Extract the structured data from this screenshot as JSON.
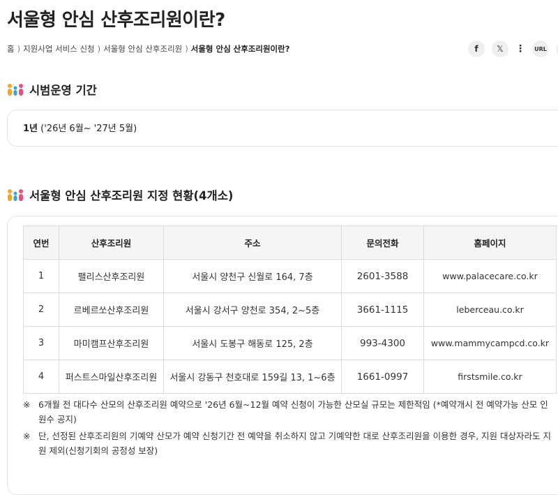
{
  "page_title": "서울형 안심 산후조리원이란?",
  "breadcrumb": {
    "items": [
      "홈",
      "지원사업 서비스 신청",
      "서울형 안심 산후조리원"
    ],
    "separator": ")",
    "current": "서울형 안심 산후조리원이란?"
  },
  "share": {
    "facebook_icon": "f",
    "x_icon": "𝕏",
    "more_icon": "⋮",
    "url_label": "URL"
  },
  "sections": {
    "period": {
      "title": "시범운영 기간",
      "value_bold": "1년",
      "value_rest": " ('26년 6월~ '27년 5월)"
    },
    "centers": {
      "title": "서울형 안심 산후조리원 지정 현황(4개소)",
      "columns": [
        "연번",
        "산후조리원",
        "주소",
        "문의전화",
        "홈페이지"
      ],
      "rows": [
        {
          "no": "1",
          "name": "팰리스산후조리원",
          "address": "서울시 양천구 신월로 164, 7층",
          "phone": "2601-3588",
          "site": "www.palacecare.co.kr"
        },
        {
          "no": "2",
          "name": "르베르쏘산후조리원",
          "address": "서울시 강서구 양천로 354, 2~5층",
          "phone": "3661-1115",
          "site": "leberceau.co.kr"
        },
        {
          "no": "3",
          "name": "마미캠프산후조리원",
          "address": "서울시 도봉구 해동로 125, 2층",
          "phone": "993-4300",
          "site": "www.mammycampcd.co.kr"
        },
        {
          "no": "4",
          "name": "퍼스트스마일산후조리원",
          "address": "서울시 강동구 천호대로 159길 13, 1~6층",
          "phone": "1661-0997",
          "site": "firstsmile.co.kr"
        }
      ]
    }
  },
  "notes": [
    {
      "mark": "※",
      "text": "6개월 전 대다수 산모의 산후조리원 예약으로 '26년 6월~12월 예약 신청이 가능한 산모실 규모는 제한적임 (*예약개시 전 예약가능 산모 인원수 공지)"
    },
    {
      "mark": "※",
      "text": "단, 선정된 산후조리원의 기예약 산모가 예약 신청기간 전 예약을 취소하지 않고 기예약한 대로 산후조리원을 이용한 경우, 지원 대상자라도 지원 제외(신청기회의 공정성 보장)"
    }
  ],
  "colors": {
    "accent_teal": "#1aa1a8",
    "icon_orange": "#f5a623",
    "icon_blue": "#3aa0e0",
    "icon_pink": "#e8517b"
  }
}
